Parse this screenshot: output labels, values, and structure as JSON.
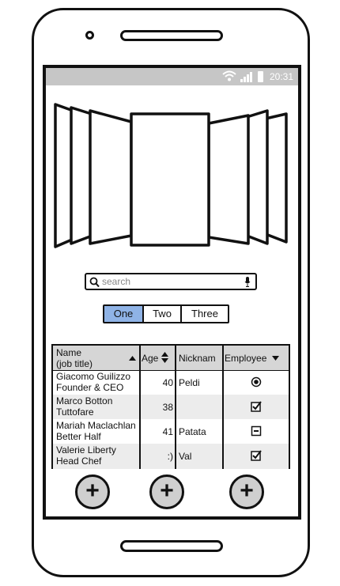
{
  "status_bar": {
    "time": "20:31",
    "icons": [
      "wifi-icon",
      "signal-icon",
      "battery-icon"
    ]
  },
  "search": {
    "placeholder": "search"
  },
  "segmented": {
    "items": [
      "One",
      "Two",
      "Three"
    ],
    "selected": "One"
  },
  "table": {
    "headers": {
      "name_line1": "Name",
      "name_line2": "(job title)",
      "age": "Age",
      "nickname": "Nicknam",
      "employee": "Employee"
    },
    "rows": [
      {
        "name": "Giacomo Guilizzo",
        "title": "Founder & CEO",
        "age": "40",
        "nickname": "Peldi",
        "employee": "radio-selected"
      },
      {
        "name": "Marco Botton",
        "title": "Tuttofare",
        "age": "38",
        "nickname": "",
        "employee": "checked"
      },
      {
        "name": "Mariah Maclachlan",
        "title": "Better Half",
        "age": "41",
        "nickname": "Patata",
        "employee": "indeterminate"
      },
      {
        "name": "Valerie Liberty",
        "title": "Head Chef",
        "age": ":)",
        "nickname": "Val",
        "employee": "checked"
      }
    ]
  },
  "buttons": {
    "add_label": "+"
  },
  "colors": {
    "selected_segment": "#8fb3e6",
    "status_bar": "#c6c6c6",
    "header_bg": "#d6d6d6"
  }
}
